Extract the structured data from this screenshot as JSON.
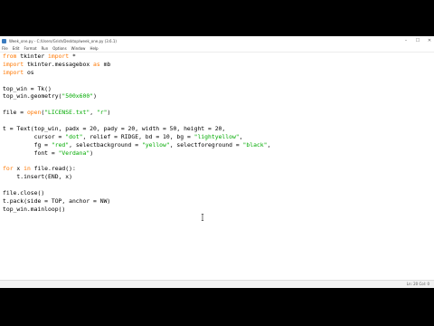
{
  "window": {
    "title": "Week_one.py - C:/Users/Grish/Desktop/week_one.py (3.6.1)",
    "controls": {
      "minimize": "–",
      "maximize": "☐",
      "close": "✕"
    }
  },
  "menubar": {
    "items": [
      "File",
      "Edit",
      "Format",
      "Run",
      "Options",
      "Window",
      "Help"
    ]
  },
  "code": {
    "lines": [
      [
        {
          "t": "from",
          "c": "kw"
        },
        {
          "t": " tkinter "
        },
        {
          "t": "import",
          "c": "kw"
        },
        {
          "t": " *"
        }
      ],
      [
        {
          "t": "import",
          "c": "kw"
        },
        {
          "t": " tkinter.messagebox "
        },
        {
          "t": "as",
          "c": "kw"
        },
        {
          "t": " mb"
        }
      ],
      [
        {
          "t": "import",
          "c": "kw"
        },
        {
          "t": " os"
        }
      ],
      [],
      [
        {
          "t": "top_win = Tk()"
        }
      ],
      [
        {
          "t": "top_win.geometry("
        },
        {
          "t": "\"500x600\"",
          "c": "str"
        },
        {
          "t": ")"
        }
      ],
      [],
      [
        {
          "t": "file = "
        },
        {
          "t": "open",
          "c": "kw"
        },
        {
          "t": "("
        },
        {
          "t": "\"LICENSE.txt\"",
          "c": "str"
        },
        {
          "t": ", "
        },
        {
          "t": "\"r\"",
          "c": "str"
        },
        {
          "t": ")"
        }
      ],
      [],
      [
        {
          "t": "t = Text(top_win, padx = 20, pady = 20, width = 50, height = 20,"
        }
      ],
      [
        {
          "t": "         cursor = "
        },
        {
          "t": "\"dot\"",
          "c": "str"
        },
        {
          "t": ", relief = RIDGE, bd = 10, bg = "
        },
        {
          "t": "\"lightyellow\"",
          "c": "str"
        },
        {
          "t": ","
        }
      ],
      [
        {
          "t": "         fg = "
        },
        {
          "t": "\"red\"",
          "c": "str"
        },
        {
          "t": ", selectbackground = "
        },
        {
          "t": "\"yellow\"",
          "c": "str"
        },
        {
          "t": ", selectforeground = "
        },
        {
          "t": "\"black\"",
          "c": "str"
        },
        {
          "t": ","
        }
      ],
      [
        {
          "t": "         font = "
        },
        {
          "t": "\"Verdana\"",
          "c": "str"
        },
        {
          "t": ")"
        }
      ],
      [],
      [
        {
          "t": "for",
          "c": "kw"
        },
        {
          "t": " x "
        },
        {
          "t": "in",
          "c": "kw"
        },
        {
          "t": " file.read():"
        }
      ],
      [
        {
          "t": "    t.insert(END, x)"
        }
      ],
      [],
      [
        {
          "t": "file.close()"
        }
      ],
      [
        {
          "t": "t.pack(side = TOP, anchor = NW)"
        }
      ],
      [
        {
          "t": "top_win.mainloop()"
        }
      ]
    ]
  },
  "statusbar": {
    "position": "Ln: 20  Col: 0"
  },
  "colors": {
    "keyword": "#ff7700",
    "string": "#00aa00",
    "text": "#000000"
  }
}
